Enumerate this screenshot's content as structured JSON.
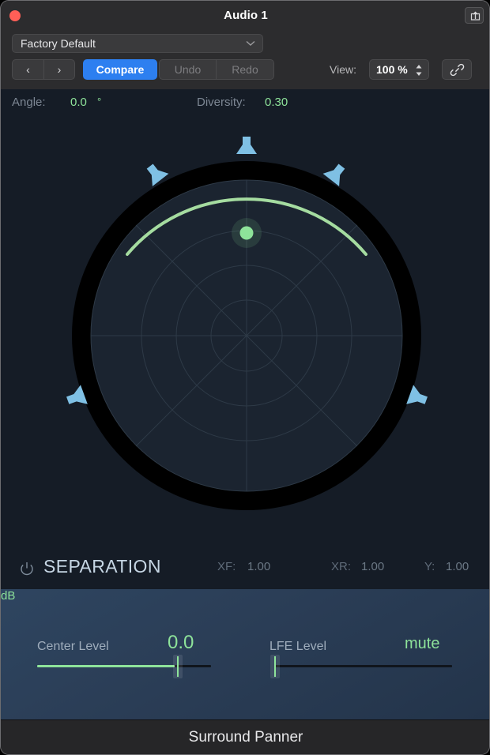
{
  "window": {
    "title": "Audio 1",
    "close_icon": "close-button",
    "export_icon": "export-share-icon"
  },
  "header": {
    "preset": {
      "value": "Factory Default",
      "chevron_icon": "chevron-down-icon"
    },
    "prev_label": "‹",
    "next_label": "›",
    "compare_label": "Compare",
    "undo_label": "Undo",
    "redo_label": "Redo",
    "view_label": "View:",
    "zoom_value": "100 %",
    "stepper_icon": "stepper-up-down-icon",
    "link_icon": "link-chain-icon"
  },
  "panner": {
    "angle_label": "Angle:",
    "angle_value": "0.0",
    "angle_unit": "°",
    "diversity_label": "Diversity:",
    "diversity_value": "0.30",
    "puck_color": "#8ee39a",
    "arc_color": "#a5dca0",
    "speaker_color": "#7fc0e4",
    "grid_color": "#2e3a47",
    "field_color": "#1b2430",
    "ring_color": "#000000",
    "speakers": [
      {
        "name": "center",
        "angle_deg": 0
      },
      {
        "name": "left-front",
        "angle_deg": -33
      },
      {
        "name": "right-front",
        "angle_deg": 33
      },
      {
        "name": "left-surround",
        "angle_deg": -109
      },
      {
        "name": "right-surround",
        "angle_deg": 109
      }
    ]
  },
  "separation": {
    "power_icon": "power-icon",
    "title": "SEPARATION",
    "items": [
      {
        "label": "XF:",
        "value": "1.00"
      },
      {
        "label": "XR:",
        "value": "1.00"
      },
      {
        "label": "Y:",
        "value": "1.00"
      }
    ]
  },
  "levels": {
    "center": {
      "name": "Center Level",
      "value": "0.0",
      "unit": "dB",
      "fill_percent": 79
    },
    "lfe": {
      "name": "LFE Level",
      "value": "mute",
      "fill_percent": 0
    },
    "accent_color": "#8ee39a"
  },
  "footer": {
    "title": "Surround Panner"
  }
}
